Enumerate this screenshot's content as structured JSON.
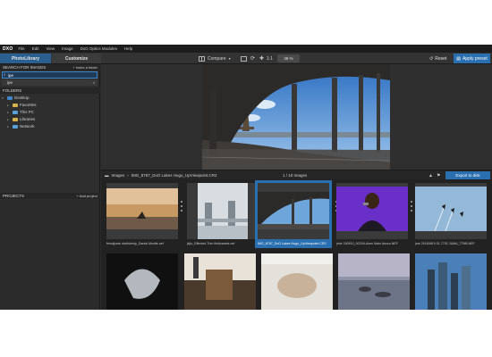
{
  "menu": {
    "logo": "DXO",
    "items": [
      "File",
      "Edit",
      "View",
      "Image",
      "DxO Optics Modules",
      "Help"
    ]
  },
  "toolbar": {
    "tab_library": "PhotoLibrary",
    "tab_customize": "Customize",
    "compare_label": "Compare",
    "ratio_label": "1:1",
    "zoom_value": "38 %",
    "reset_label": "Reset",
    "apply_label": "Apply preset"
  },
  "left": {
    "search_header": "SEARCH FOR IMAGES",
    "index_label": "+ index a folder",
    "search_value": "ipe",
    "search_result": "ipe",
    "search_result_count": "4",
    "folders_header": "FOLDERS",
    "tree": [
      "Desktop",
      "Favorites",
      "This PC",
      "Libraries",
      "Network"
    ],
    "projects_header": "PROJECTS",
    "add_project_label": "+ Add project"
  },
  "browser": {
    "crumb_root": "Images",
    "crumb_file": "IMG_8787_DxO Lakes Hugo_UpViewpoint.CR2",
    "image_count": "1 / 10 Images",
    "export_label": "Export to disk",
    "thumbs": [
      {
        "caption": "fenwijzwic stethdenty_Danial Montts.nef"
      },
      {
        "caption": "jkjlo_Effected.Trim fieldvavets.nef"
      },
      {
        "caption": "IMG_8787_DxO Lakes Hugo_UpViewpoint.CR2"
      },
      {
        "caption": "jmie 150910_002IVLAxen Main Anocs.NEF"
      },
      {
        "caption": "jme 20160819 01.7792 JUMA_77NB.NEF"
      },
      {
        "caption": ""
      },
      {
        "caption": ""
      },
      {
        "caption": ""
      },
      {
        "caption": ""
      },
      {
        "caption": ""
      }
    ]
  },
  "colors": {
    "accent": "#2a6fb0",
    "panel": "#2b2b2b",
    "menubar": "#1d1d1d"
  }
}
